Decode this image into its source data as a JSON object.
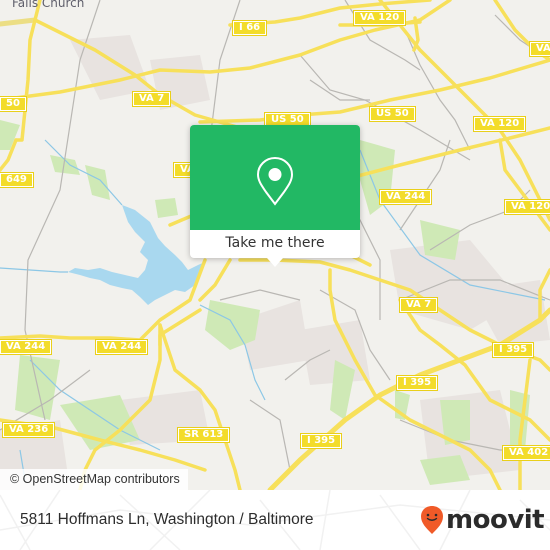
{
  "map": {
    "place_label": "Falls Church",
    "attribution": "© OpenStreetMap contributors",
    "colors": {
      "land": "#f2f1ed",
      "road": "#f7e05a",
      "minor_road": "#b9b7b3",
      "water": "#a9d8ef",
      "park": "#cfe9b6",
      "residential": "#e8e3e0"
    },
    "shields": [
      {
        "label": "I 66"
      },
      {
        "label": "VA 120"
      },
      {
        "label": "US 50"
      },
      {
        "label": "VA 7"
      },
      {
        "label": "US 50"
      },
      {
        "label": "VA 120"
      },
      {
        "label": "VA"
      },
      {
        "label": "649"
      },
      {
        "label": "VA 244"
      },
      {
        "label": "VA 120"
      },
      {
        "label": "VA 7"
      },
      {
        "label": "I 395"
      },
      {
        "label": "VA 244"
      },
      {
        "label": "VA 244"
      },
      {
        "label": "I 395"
      },
      {
        "label": "VA 236"
      },
      {
        "label": "SR 613"
      },
      {
        "label": "I 395"
      },
      {
        "label": "VA 402"
      },
      {
        "label": "50"
      },
      {
        "label": "VA"
      }
    ]
  },
  "popup": {
    "icon": "location-pin-icon",
    "button_label": "Take me there",
    "color": "#22b864"
  },
  "footer": {
    "address": "5811 Hoffmans Ln, Washington / Baltimore",
    "brand": "moovit",
    "brand_icon": "moovit-smiley-pin-icon",
    "brand_color": "#f05a28"
  }
}
